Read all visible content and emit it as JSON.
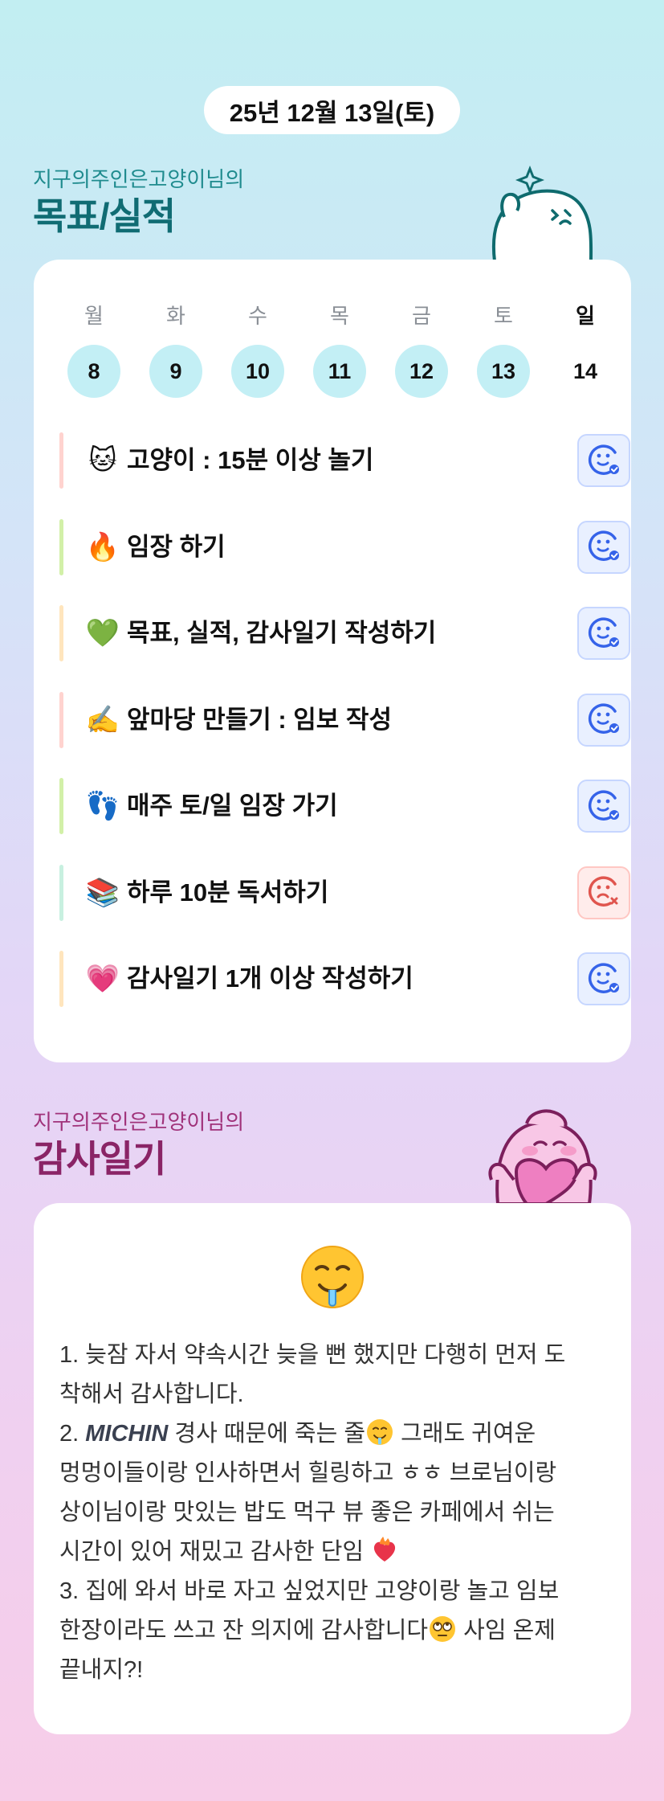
{
  "date": "25년 12월 13일(토)",
  "goals_section": {
    "subtitle": "지구의주인은고양이님의",
    "title": "목표/실적"
  },
  "week": [
    {
      "day": "월",
      "num": "8",
      "done": true
    },
    {
      "day": "화",
      "num": "9",
      "done": true
    },
    {
      "day": "수",
      "num": "10",
      "done": true
    },
    {
      "day": "목",
      "num": "11",
      "done": true
    },
    {
      "day": "금",
      "num": "12",
      "done": true
    },
    {
      "day": "토",
      "num": "13",
      "done": true
    },
    {
      "day": "일",
      "num": "14",
      "done": false
    }
  ],
  "goals": [
    {
      "emoji": "🐱",
      "text": "고양이 : 15분 이상 놀기",
      "bar_color": "#ffd3cf",
      "status": "success"
    },
    {
      "emoji": "🔥",
      "text": "임장 하기",
      "bar_color": "#d2f0a8",
      "status": "success"
    },
    {
      "emoji": "💚",
      "text": "목표, 실적, 감사일기 작성하기",
      "bar_color": "#ffe5bd",
      "status": "success"
    },
    {
      "emoji": "✍️",
      "text": "앞마당 만들기 : 임보 작성",
      "bar_color": "#ffd3cf",
      "status": "success"
    },
    {
      "emoji": "👣",
      "text": "매주 토/일 임장 가기",
      "bar_color": "#d2f0a8",
      "status": "success"
    },
    {
      "emoji": "📚",
      "text": "하루 10분 독서하기",
      "bar_color": "#c8f0e0",
      "status": "fail"
    },
    {
      "emoji": "💗",
      "text": "감사일기 1개 이상 작성하기",
      "bar_color": "#ffe5bd",
      "status": "success"
    }
  ],
  "diary_section": {
    "subtitle": "지구의주인은고양이님의",
    "title": "감사일기"
  },
  "diary": {
    "line1": "1. 늦잠 자서 약속시간 늦을 뻔 했지만 다행히 먼저 도",
    "line2": "착해서 감사합니다.",
    "line3_a": "2. ",
    "line3_b": "MICHIN",
    "line3_c": " 경사 때문에 죽는 줄",
    "line3_d": " 그래도 귀여운",
    "line4": "멍멍이들이랑 인사하면서 힐링하고 ㅎㅎ 브로님이랑",
    "line5": "상이님이랑 맛있는 밥도 먹구 뷰 좋은 카페에서 쉬는",
    "line6": "시간이 있어 재밌고 감사한 단임",
    "line7": "3. 집에 와서 바로 자고 싶었지만 고양이랑 놀고 임보",
    "line8_a": "한장이라도 쓰고 잔 의지에 감사합니다",
    "line8_b": " 사임 온제",
    "line9": "끝내지?!"
  },
  "colors": {
    "accent_teal": "#106c73",
    "accent_pink": "#8a2466",
    "success_blue": "#3563e9",
    "fail_red": "#e0554e"
  },
  "icons": {
    "success": "smile-check-icon",
    "fail": "frown-x-icon"
  }
}
